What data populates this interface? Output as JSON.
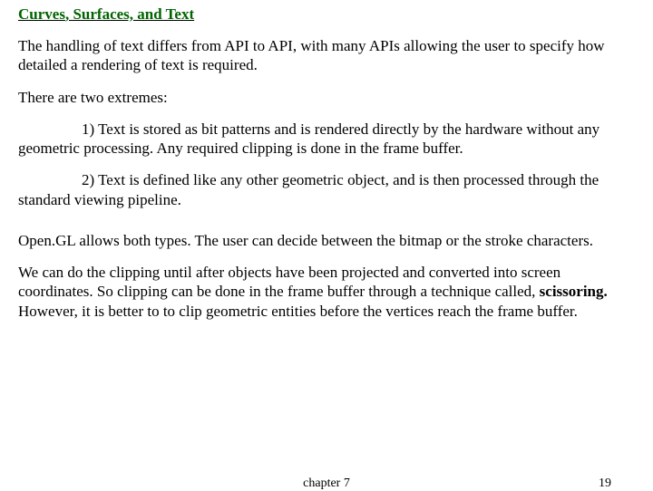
{
  "heading": {
    "pre": "Curves",
    "rest": ", Surfaces, and Text"
  },
  "p1": "The handling of text differs from API to API, with many APIs allowing the user to specify how detailed a rendering of text is required.",
  "p2": "There are two extremes:",
  "p3": "1) Text is stored as bit patterns and is rendered directly by the hardware without any geometric processing. Any required clipping is done in the frame buffer.",
  "p4": "2) Text is defined like any other geometric object, and is then processed through the standard viewing pipeline.",
  "p5": "Open.GL allows both types.  The user can decide between the bitmap or the stroke characters.",
  "p6a": "We can do the clipping until after objects have been projected and converted into screen coordinates.  So clipping can be done in the frame buffer through a technique called, ",
  "p6b": "scissoring.",
  "p6c": "  However, it is better to to clip geometric entities before the vertices reach the frame buffer.",
  "footer": {
    "chapter": "chapter 7",
    "page": "19"
  }
}
